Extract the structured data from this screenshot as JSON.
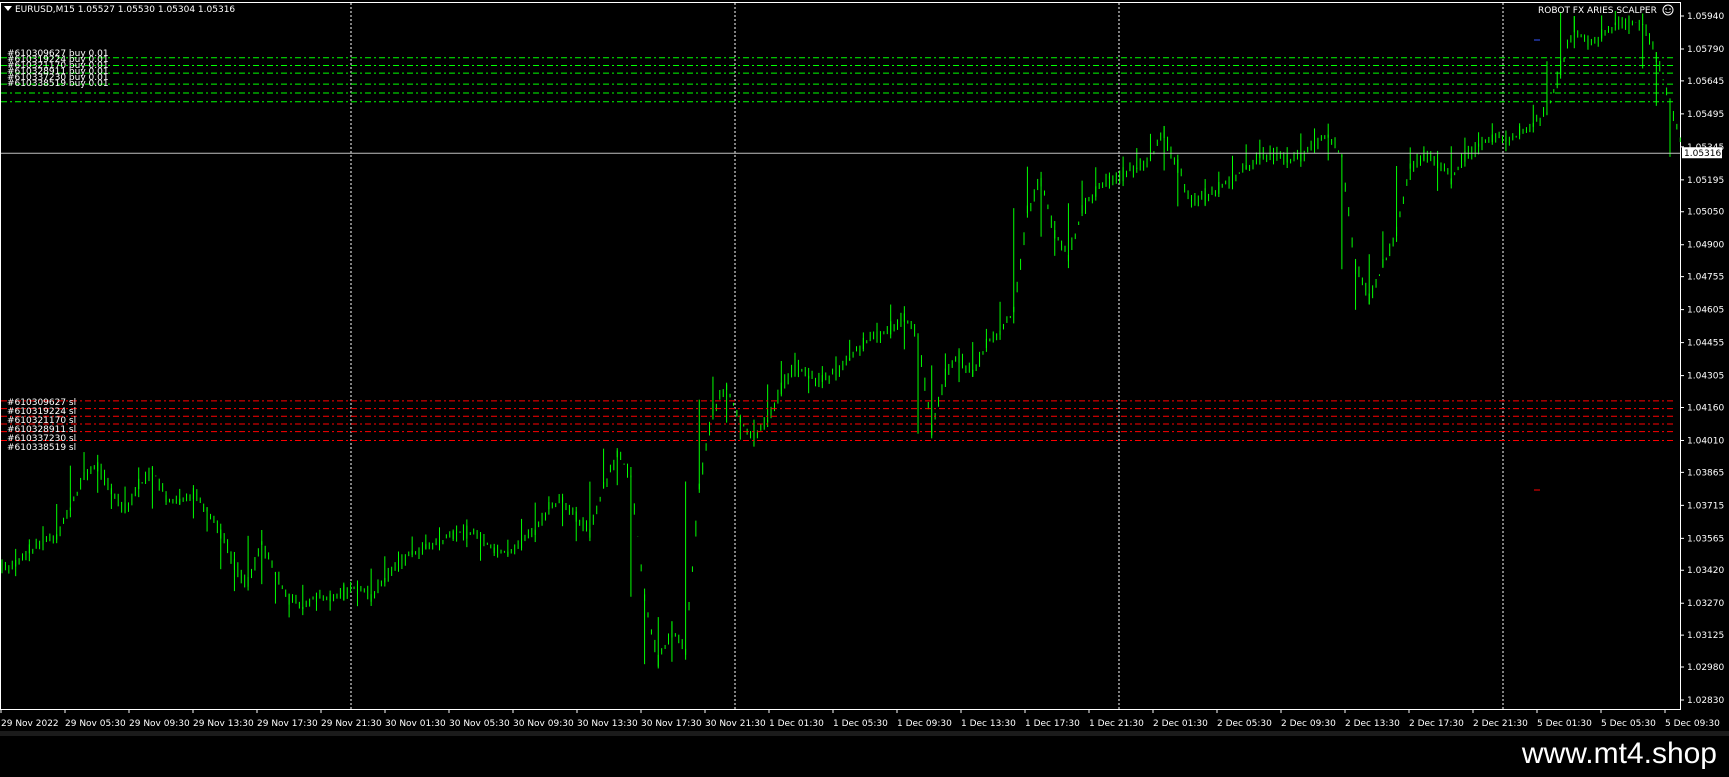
{
  "symbol_header": {
    "text": "EURUSD,M15  1.05527 1.05530 1.05304 1.05316"
  },
  "expert": {
    "name": "ROBOT FX ARIES SCALPER",
    "icon": "smiley-icon"
  },
  "colors": {
    "background": "#000000",
    "candle": "#00ff00",
    "order_line": "#00ff00",
    "stoploss_line": "#ff0000",
    "bid_line": "#c0c0c0",
    "grid": "#ffffff"
  },
  "orders": [
    {
      "label": "#610309627 buy 0.01",
      "price": 1.0575
    },
    {
      "label": "#610319224 buy 0.01",
      "price": 1.05715
    },
    {
      "label": "#610321170 buy 0.01",
      "price": 1.0568
    },
    {
      "label": "#610328911 buy 0.01",
      "price": 1.0563
    },
    {
      "label": "#610337230 buy 0.01",
      "price": 1.0559
    },
    {
      "label": "#610338519 buy 0.01",
      "price": 1.0555
    }
  ],
  "stop_losses": [
    {
      "label": "#610309627 sl",
      "price": 1.0419
    },
    {
      "label": "#610319224 sl",
      "price": 1.04155
    },
    {
      "label": "#610321170 sl",
      "price": 1.0412
    },
    {
      "label": "#610328911 sl",
      "price": 1.04085
    },
    {
      "label": "#610337230 sl",
      "price": 1.0405
    },
    {
      "label": "#610338519 sl",
      "price": 1.0401
    }
  ],
  "current_price": {
    "value": 1.05316,
    "label": "1.05316"
  },
  "price_axis": {
    "ticks": [
      "1.05940",
      "1.05790",
      "1.05645",
      "1.05495",
      "1.05345",
      "1.05195",
      "1.05050",
      "1.04900",
      "1.04755",
      "1.04605",
      "1.04455",
      "1.04305",
      "1.04160",
      "1.04010",
      "1.03865",
      "1.03715",
      "1.03565",
      "1.03420",
      "1.03270",
      "1.03125",
      "1.02980",
      "1.02830"
    ]
  },
  "time_axis": {
    "labels": [
      "29 Nov 2022",
      "29 Nov 05:30",
      "29 Nov 09:30",
      "29 Nov 13:30",
      "29 Nov 17:30",
      "29 Nov 21:30",
      "30 Nov 01:30",
      "30 Nov 05:30",
      "30 Nov 09:30",
      "30 Nov 13:30",
      "30 Nov 17:30",
      "30 Nov 21:30",
      "1 Dec 01:30",
      "1 Dec 05:30",
      "1 Dec 09:30",
      "1 Dec 13:30",
      "1 Dec 17:30",
      "1 Dec 21:30",
      "2 Dec 01:30",
      "2 Dec 05:30",
      "2 Dec 09:30",
      "2 Dec 13:30",
      "2 Dec 17:30",
      "2 Dec 21:30",
      "5 Dec 01:30",
      "5 Dec 05:30",
      "5 Dec 09:30"
    ]
  },
  "chart_data": {
    "type": "line",
    "title": "",
    "xlabel": "",
    "ylabel": "",
    "ylim": [
      1.0283,
      1.0594
    ],
    "grid": true,
    "period_separators_at": [
      "29 Nov 21:30",
      "30 Nov 21:30",
      "1 Dec 21:30",
      "2 Dec 21:30"
    ],
    "series": [
      {
        "values": [
          1.0344,
          1.035,
          1.0355,
          1.0358,
          1.037,
          1.0385,
          1.039,
          1.0378,
          1.037,
          1.038,
          1.0388,
          1.0375,
          1.0372,
          1.0378,
          1.037,
          1.036,
          1.0345,
          1.0335,
          1.0355,
          1.034,
          1.033,
          1.0325,
          1.033,
          1.0328,
          1.0332,
          1.0335,
          1.033,
          1.0338,
          1.0345,
          1.035,
          1.0352,
          1.0355,
          1.0358,
          1.036,
          1.0357,
          1.0352,
          1.035,
          1.0355,
          1.036,
          1.037,
          1.0375,
          1.0365,
          1.036,
          1.038,
          1.0395,
          1.0385,
          1.033,
          1.03,
          1.0315,
          1.0305,
          1.038,
          1.0415,
          1.0425,
          1.041,
          1.0402,
          1.041,
          1.0425,
          1.0435,
          1.043,
          1.0428,
          1.0432,
          1.0438,
          1.0445,
          1.0448,
          1.0452,
          1.0458,
          1.0448,
          1.0405,
          1.043,
          1.044,
          1.043,
          1.0445,
          1.045,
          1.046,
          1.0505,
          1.052,
          1.0495,
          1.0485,
          1.0505,
          1.0515,
          1.052,
          1.0522,
          1.0525,
          1.053,
          1.054,
          1.0525,
          1.051,
          1.0512,
          1.0515,
          1.052,
          1.0525,
          1.053,
          1.0532,
          1.0528,
          1.053,
          1.0535,
          1.054,
          1.053,
          1.048,
          1.0465,
          1.048,
          1.0495,
          1.0525,
          1.053,
          1.0528,
          1.052,
          1.053,
          1.0535,
          1.054,
          1.0538,
          1.054,
          1.0545,
          1.055,
          1.057,
          1.059,
          1.058,
          1.0585,
          1.059,
          1.0592,
          1.059,
          1.0575,
          1.0555,
          1.05316
        ]
      }
    ]
  },
  "watermark": "www.mt4.shop"
}
